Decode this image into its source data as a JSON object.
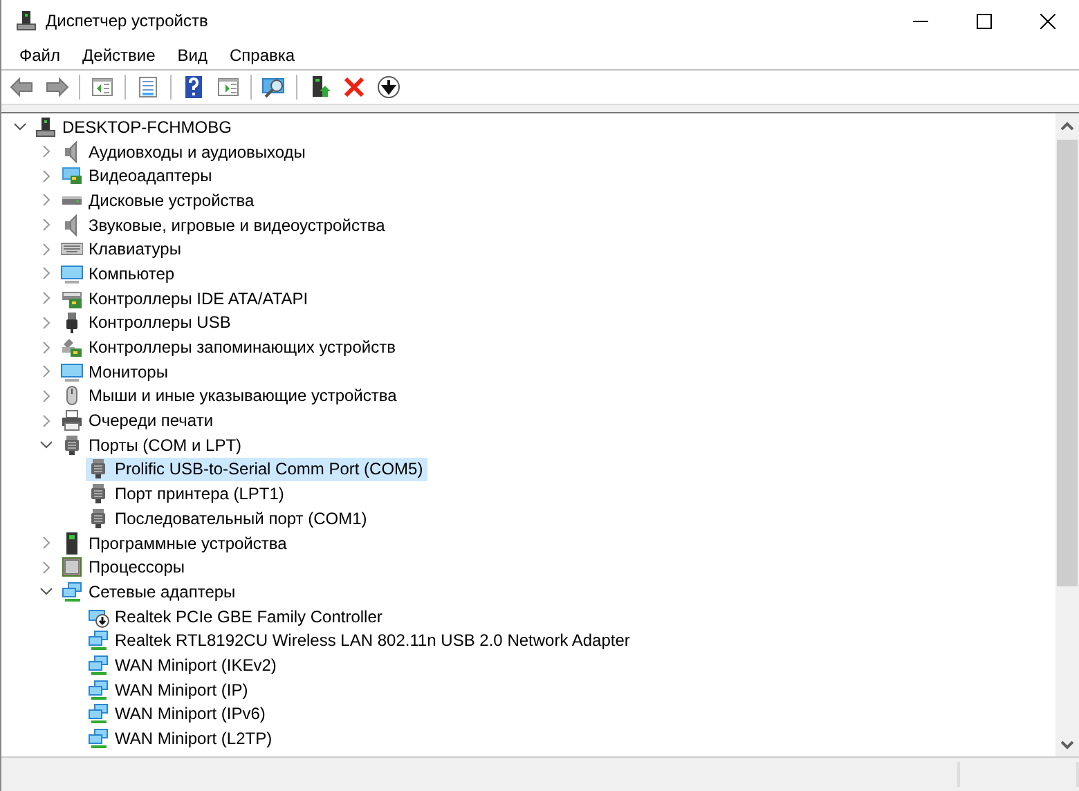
{
  "window": {
    "title": "Диспетчер устройств"
  },
  "menu": [
    {
      "label": "Файл"
    },
    {
      "label": "Действие"
    },
    {
      "label": "Вид"
    },
    {
      "label": "Справка"
    }
  ],
  "tree": {
    "label": "DESKTOP-FCHMOBG",
    "kind": "computer",
    "expanded": true,
    "selected": false,
    "children": [
      {
        "label": "Аудиовходы и аудиовыходы",
        "kind": "speaker",
        "expanded": false,
        "selected": false
      },
      {
        "label": "Видеоадаптеры",
        "kind": "video",
        "expanded": false,
        "selected": false
      },
      {
        "label": "Дисковые устройства",
        "kind": "disk",
        "expanded": false,
        "selected": false
      },
      {
        "label": "Звуковые, игровые и видеоустройства",
        "kind": "speaker",
        "expanded": false,
        "selected": false
      },
      {
        "label": "Клавиатуры",
        "kind": "keyboard",
        "expanded": false,
        "selected": false
      },
      {
        "label": "Компьютер",
        "kind": "monitor",
        "expanded": false,
        "selected": false
      },
      {
        "label": "Контроллеры IDE ATA/ATAPI",
        "kind": "controller",
        "expanded": false,
        "selected": false
      },
      {
        "label": "Контроллеры USB",
        "kind": "usb",
        "expanded": false,
        "selected": false
      },
      {
        "label": "Контроллеры запоминающих устройств",
        "kind": "storage",
        "expanded": false,
        "selected": false
      },
      {
        "label": "Мониторы",
        "kind": "monitor",
        "expanded": false,
        "selected": false
      },
      {
        "label": "Мыши и иные указывающие устройства",
        "kind": "mouse",
        "expanded": false,
        "selected": false
      },
      {
        "label": "Очереди печати",
        "kind": "printer",
        "expanded": false,
        "selected": false
      },
      {
        "label": "Порты (COM и LPT)",
        "kind": "port",
        "expanded": true,
        "selected": false,
        "children": [
          {
            "label": "Prolific USB-to-Serial Comm Port (COM5)",
            "kind": "port",
            "selected": true
          },
          {
            "label": "Порт принтера (LPT1)",
            "kind": "port",
            "selected": false
          },
          {
            "label": "Последовательный порт (COM1)",
            "kind": "port",
            "selected": false
          }
        ]
      },
      {
        "label": "Программные устройства",
        "kind": "firmware",
        "expanded": false,
        "selected": false
      },
      {
        "label": "Процессоры",
        "kind": "cpu",
        "expanded": false,
        "selected": false
      },
      {
        "label": "Сетевые адаптеры",
        "kind": "network",
        "expanded": true,
        "selected": false,
        "children": [
          {
            "label": "Realtek PCIe GBE Family Controller",
            "kind": "network-disabled",
            "selected": false
          },
          {
            "label": "Realtek RTL8192CU Wireless LAN 802.11n USB 2.0 Network Adapter",
            "kind": "network",
            "selected": false
          },
          {
            "label": "WAN Miniport (IKEv2)",
            "kind": "network",
            "selected": false
          },
          {
            "label": "WAN Miniport (IP)",
            "kind": "network",
            "selected": false
          },
          {
            "label": "WAN Miniport (IPv6)",
            "kind": "network",
            "selected": false
          },
          {
            "label": "WAN Miniport (L2TP)",
            "kind": "network",
            "selected": false
          }
        ]
      }
    ]
  }
}
